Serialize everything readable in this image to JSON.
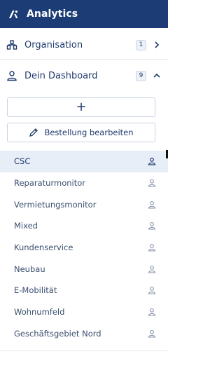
{
  "app": {
    "title": "Analytics"
  },
  "sections": [
    {
      "label": "Organisation",
      "count": "1",
      "expanded": false
    },
    {
      "label": "Dein Dashboard",
      "count": "9",
      "expanded": true
    }
  ],
  "actions": {
    "add_label": "+",
    "edit_label": "Bestellung bearbeiten"
  },
  "dashboards": [
    {
      "label": "CSC",
      "selected": true
    },
    {
      "label": "Reparaturmonitor"
    },
    {
      "label": "Vermietungsmonitor"
    },
    {
      "label": "Mixed"
    },
    {
      "label": "Kundenservice"
    },
    {
      "label": "Neubau"
    },
    {
      "label": "E-Mobilität"
    },
    {
      "label": "Wohnumfeld"
    },
    {
      "label": "Geschäftsgebiet Nord"
    }
  ],
  "colors": {
    "header_bg": "#1b3c74",
    "text_primary": "#1f3a6b",
    "selected_bg": "#e8eef8"
  },
  "icons": {
    "logo": "analytics-logo-icon",
    "organisation": "org-chart-icon",
    "dashboard": "person-icon",
    "edit": "pencil-icon",
    "item": "person-outline-icon"
  }
}
